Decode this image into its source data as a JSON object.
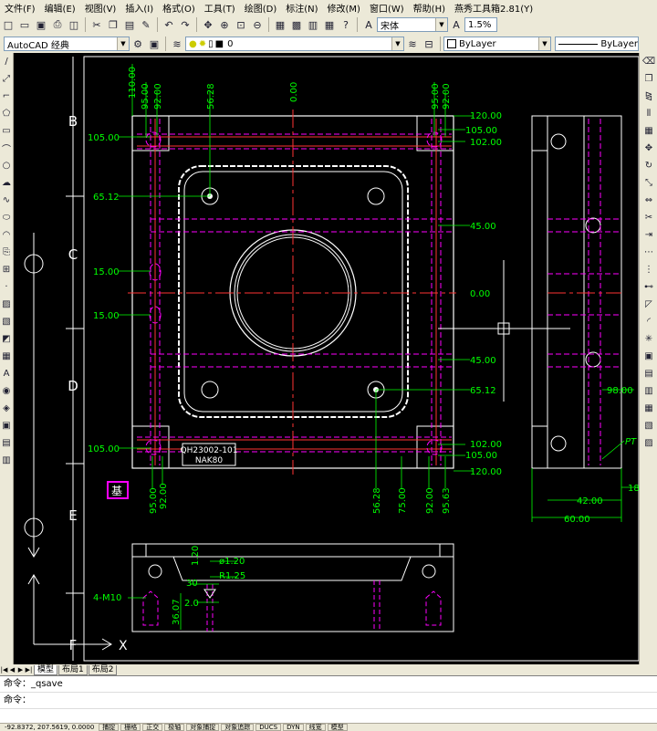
{
  "menu": [
    "文件(F)",
    "编辑(E)",
    "视图(V)",
    "插入(I)",
    "格式(O)",
    "工具(T)",
    "绘图(D)",
    "标注(N)",
    "修改(M)",
    "窗口(W)",
    "帮助(H)",
    "燕秀工具箱2.81(Y)"
  ],
  "toolbar": {
    "font_name": "宋体",
    "text_height": "1.5%",
    "workspace": "AutoCAD 经典",
    "layer": "0",
    "color": "ByLayer",
    "linetype": "ByLayer"
  },
  "drawing": {
    "zone_labels": [
      "B",
      "C",
      "D",
      "E",
      "F"
    ],
    "top_dims": [
      "110.00",
      "95.00",
      "92.00",
      "56.28",
      "0.00",
      "95.00",
      "92.00"
    ],
    "right_dims": [
      "120.00",
      "105.00",
      "102.00",
      "45.00",
      "0.00",
      "45.00",
      "65.12",
      "102.00",
      "105.00",
      "120.00"
    ],
    "left_dims": [
      "105.00",
      "65.12",
      "15.00",
      "15.00",
      "105.00"
    ],
    "bottom_dims": [
      "95.00",
      "92.00",
      "56.28",
      "75.00",
      "92.00",
      "95.63"
    ],
    "plate_label": [
      "QH23002-101",
      "NAK80"
    ],
    "datum_label": "基",
    "side_dims": [
      "98.00",
      "42.00",
      "60.00",
      "18",
      "PT"
    ],
    "section_labels": [
      "4-M10",
      "36.07",
      "2.0",
      "ø1.20",
      "R1.25",
      "1.20",
      "30"
    ]
  },
  "layout_tabs": [
    "模型",
    "布局1",
    "布局2"
  ],
  "command": {
    "history": "命令：_qsave",
    "prompt": "命令：",
    "input": ""
  },
  "status": {
    "coords": "-92.8372, 207.5619, 0.0000",
    "toggles": [
      "捕捉",
      "栅格",
      "正交",
      "极轴",
      "对象捕捉",
      "对象追踪",
      "DUCS",
      "DYN",
      "线宽",
      "模型"
    ]
  },
  "colors": {
    "green": "#00ff00",
    "red": "#ff3333",
    "magenta": "#ff00ff",
    "cyan": "#00ffff",
    "yellow": "#ffff00"
  }
}
